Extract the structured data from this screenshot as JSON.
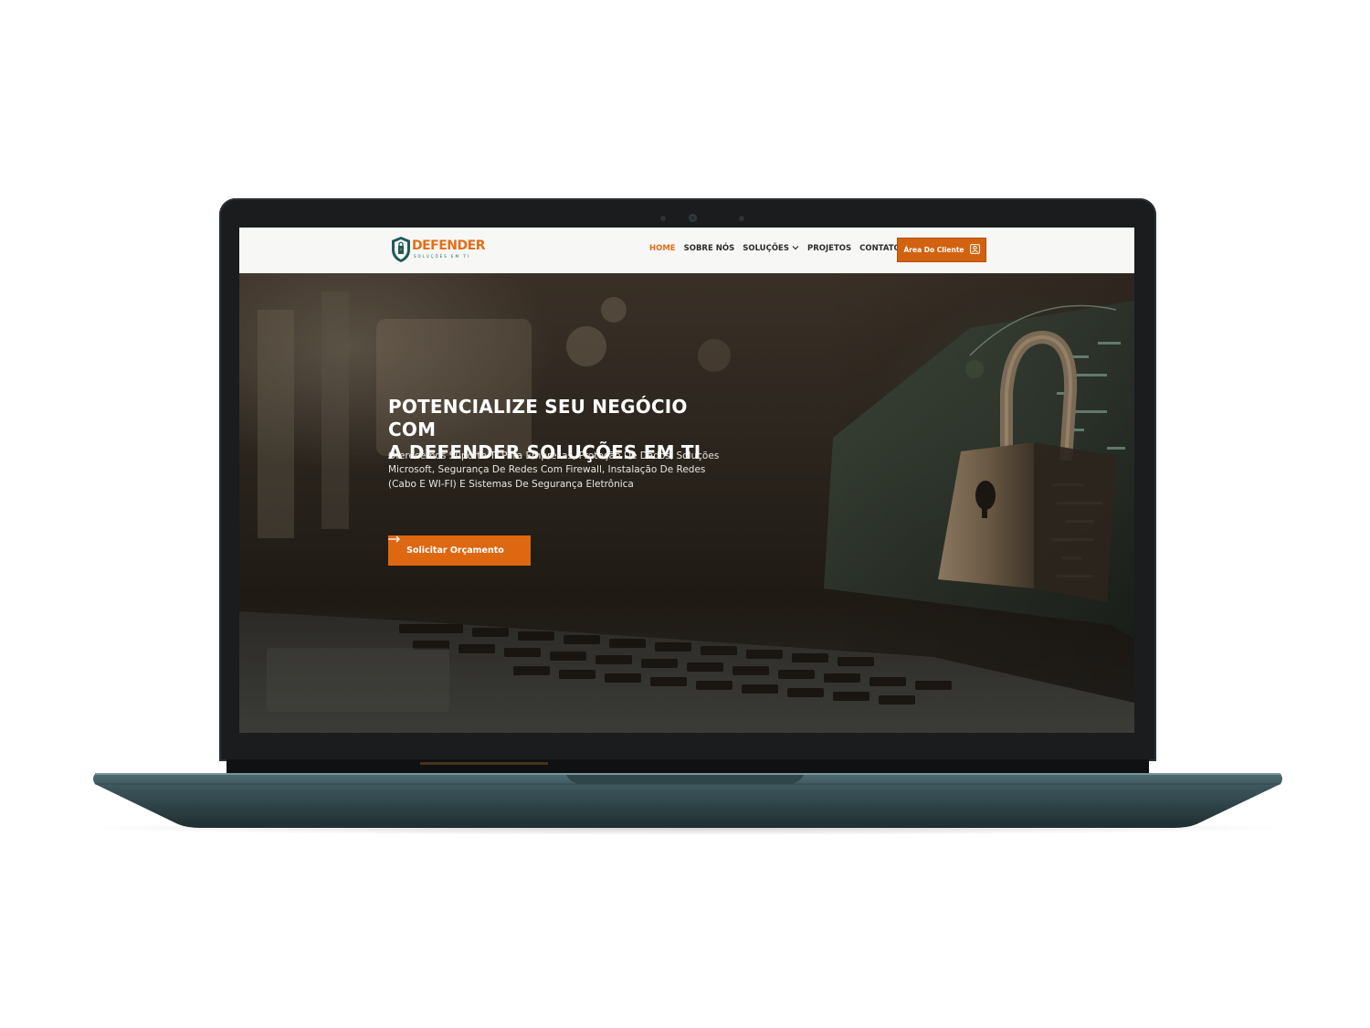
{
  "site": {
    "logo": {
      "name": "DEFENDER",
      "tagline": "SOLUÇÕES EM TI"
    },
    "nav": {
      "items": [
        {
          "label": "HOME",
          "active": true
        },
        {
          "label": "SOBRE NÓS",
          "active": false
        },
        {
          "label": "SOLUÇÕES",
          "active": false,
          "has_dropdown": true
        },
        {
          "label": "PROJETOS",
          "active": false
        },
        {
          "label": "CONTATO",
          "active": false
        }
      ],
      "client_button": {
        "label": "Área Do Cliente",
        "icon": "user-icon"
      }
    },
    "hero": {
      "title": "POTENCIALIZE SEU NEGÓCIO COM\nA DEFENDER SOLUÇÕES EM TI",
      "text": "Oferecemos Suporte TI Para Empresas, Proteção De Dados, Soluções Microsoft, Segurança De Redes Com Firewall, Instalação De Redes (Cabo E WI-FI) E Sistemas De Segurança Eletrônica",
      "cta": {
        "label": "Solicitar Orçamento",
        "icon": "arrow-right-icon"
      },
      "background": "padlock-keyboard-photo"
    }
  },
  "colors": {
    "accent": "#e36d19",
    "header_bg": "#f7f7f5",
    "logo_teal": "#1f5a5c",
    "laptop_body": "#3f5a60"
  }
}
